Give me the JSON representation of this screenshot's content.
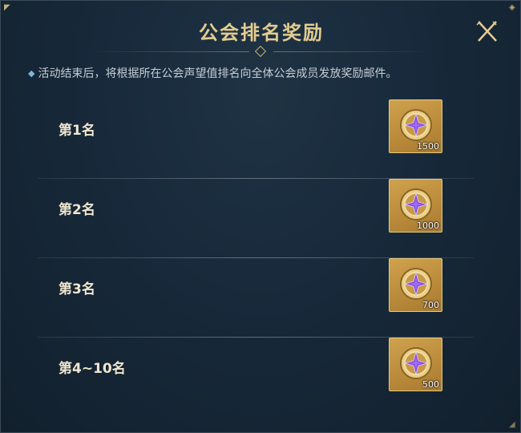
{
  "panel": {
    "title": "公会排名奖励",
    "tip": "活动结束后，将根据所在公会声望值排名向全体公会成员发放奖励邮件。"
  },
  "colors": {
    "title": "#e3cc8f",
    "reward_bg": "#b98a3a",
    "gem": "#7a3fd0"
  },
  "rewards": [
    {
      "rank": "第1名",
      "item_icon": "purple-star-coin-icon",
      "count": "1500"
    },
    {
      "rank": "第2名",
      "item_icon": "purple-star-coin-icon",
      "count": "1000"
    },
    {
      "rank": "第3名",
      "item_icon": "purple-star-coin-icon",
      "count": "700"
    },
    {
      "rank": "第4~10名",
      "item_icon": "purple-star-coin-icon",
      "count": "500"
    }
  ]
}
